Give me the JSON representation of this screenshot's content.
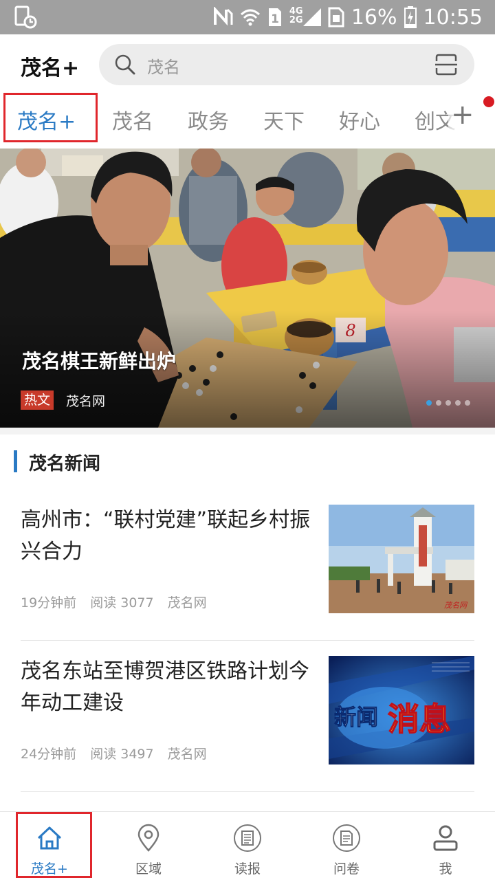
{
  "status_bar": {
    "network_labels": [
      "4G",
      "2G"
    ],
    "sim_slot": "1",
    "battery": "16%",
    "time": "10:55",
    "icons": [
      "screen-time-icon",
      "nfc-icon",
      "wifi-icon",
      "sim-icon",
      "signal-icon",
      "sim-card-icon",
      "battery-charging-icon"
    ]
  },
  "header": {
    "app_title": "茂名+",
    "search_placeholder": "茂名"
  },
  "tabs": [
    {
      "label": "茂名+",
      "active": true
    },
    {
      "label": "茂名",
      "active": false
    },
    {
      "label": "政务",
      "active": false
    },
    {
      "label": "天下",
      "active": false
    },
    {
      "label": "好心",
      "active": false
    },
    {
      "label": "创文",
      "active": false
    }
  ],
  "tab_add_label": "+",
  "banner": {
    "title": "茂名棋王新鲜出炉",
    "tag": "热文",
    "source": "茂名网",
    "slide_count": 5,
    "active_slide": 1,
    "card_number": "8"
  },
  "section": {
    "title": "茂名新闻"
  },
  "news": [
    {
      "title": "高州市：“联村党建”联起乡村振兴合力",
      "time": "19分钟前",
      "reads": "阅读 3077",
      "source": "茂名网",
      "thumb_watermark": "茂名网"
    },
    {
      "title": "茂名东站至博贺港区铁路计划今年动工建设",
      "time": "24分钟前",
      "reads": "阅读 3497",
      "source": "茂名网",
      "thumb_text_1": "新闻",
      "thumb_text_2": "消息"
    }
  ],
  "bottom_nav": [
    {
      "label": "茂名+",
      "icon": "home-icon",
      "active": true
    },
    {
      "label": "区域",
      "icon": "location-pin-icon",
      "active": false
    },
    {
      "label": "读报",
      "icon": "newspaper-icon",
      "active": false
    },
    {
      "label": "问卷",
      "icon": "survey-icon",
      "active": false
    },
    {
      "label": "我",
      "icon": "user-icon",
      "active": false
    }
  ],
  "colors": {
    "accent": "#2a7ac4",
    "highlight_box": "#e0262c",
    "status_bar": "#a0a0a0",
    "tag": "#c83a2a"
  }
}
